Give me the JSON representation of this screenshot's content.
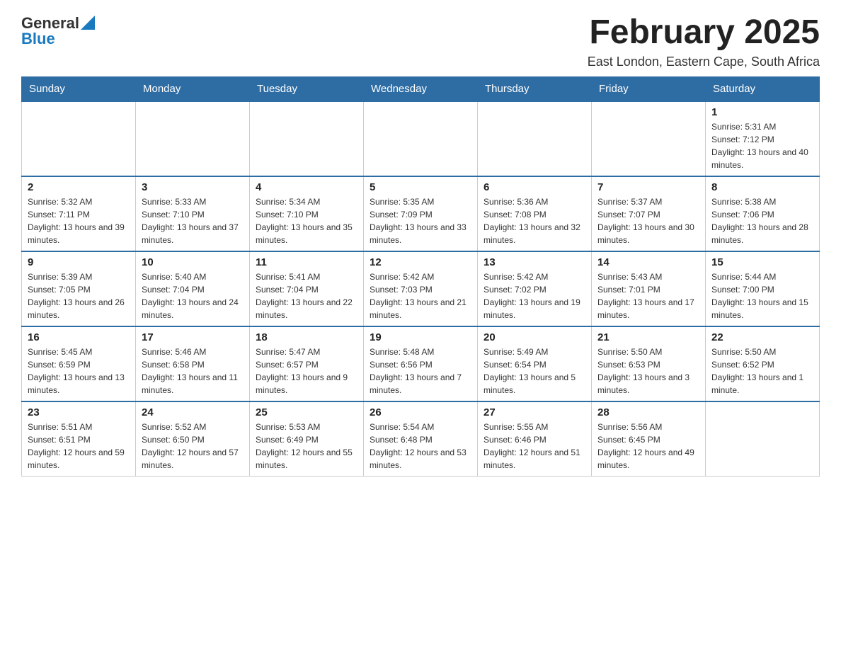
{
  "logo": {
    "general": "General",
    "blue": "Blue"
  },
  "title": "February 2025",
  "location": "East London, Eastern Cape, South Africa",
  "weekdays": [
    "Sunday",
    "Monday",
    "Tuesday",
    "Wednesday",
    "Thursday",
    "Friday",
    "Saturday"
  ],
  "weeks": [
    [
      {
        "day": "",
        "info": ""
      },
      {
        "day": "",
        "info": ""
      },
      {
        "day": "",
        "info": ""
      },
      {
        "day": "",
        "info": ""
      },
      {
        "day": "",
        "info": ""
      },
      {
        "day": "",
        "info": ""
      },
      {
        "day": "1",
        "info": "Sunrise: 5:31 AM\nSunset: 7:12 PM\nDaylight: 13 hours and 40 minutes."
      }
    ],
    [
      {
        "day": "2",
        "info": "Sunrise: 5:32 AM\nSunset: 7:11 PM\nDaylight: 13 hours and 39 minutes."
      },
      {
        "day": "3",
        "info": "Sunrise: 5:33 AM\nSunset: 7:10 PM\nDaylight: 13 hours and 37 minutes."
      },
      {
        "day": "4",
        "info": "Sunrise: 5:34 AM\nSunset: 7:10 PM\nDaylight: 13 hours and 35 minutes."
      },
      {
        "day": "5",
        "info": "Sunrise: 5:35 AM\nSunset: 7:09 PM\nDaylight: 13 hours and 33 minutes."
      },
      {
        "day": "6",
        "info": "Sunrise: 5:36 AM\nSunset: 7:08 PM\nDaylight: 13 hours and 32 minutes."
      },
      {
        "day": "7",
        "info": "Sunrise: 5:37 AM\nSunset: 7:07 PM\nDaylight: 13 hours and 30 minutes."
      },
      {
        "day": "8",
        "info": "Sunrise: 5:38 AM\nSunset: 7:06 PM\nDaylight: 13 hours and 28 minutes."
      }
    ],
    [
      {
        "day": "9",
        "info": "Sunrise: 5:39 AM\nSunset: 7:05 PM\nDaylight: 13 hours and 26 minutes."
      },
      {
        "day": "10",
        "info": "Sunrise: 5:40 AM\nSunset: 7:04 PM\nDaylight: 13 hours and 24 minutes."
      },
      {
        "day": "11",
        "info": "Sunrise: 5:41 AM\nSunset: 7:04 PM\nDaylight: 13 hours and 22 minutes."
      },
      {
        "day": "12",
        "info": "Sunrise: 5:42 AM\nSunset: 7:03 PM\nDaylight: 13 hours and 21 minutes."
      },
      {
        "day": "13",
        "info": "Sunrise: 5:42 AM\nSunset: 7:02 PM\nDaylight: 13 hours and 19 minutes."
      },
      {
        "day": "14",
        "info": "Sunrise: 5:43 AM\nSunset: 7:01 PM\nDaylight: 13 hours and 17 minutes."
      },
      {
        "day": "15",
        "info": "Sunrise: 5:44 AM\nSunset: 7:00 PM\nDaylight: 13 hours and 15 minutes."
      }
    ],
    [
      {
        "day": "16",
        "info": "Sunrise: 5:45 AM\nSunset: 6:59 PM\nDaylight: 13 hours and 13 minutes."
      },
      {
        "day": "17",
        "info": "Sunrise: 5:46 AM\nSunset: 6:58 PM\nDaylight: 13 hours and 11 minutes."
      },
      {
        "day": "18",
        "info": "Sunrise: 5:47 AM\nSunset: 6:57 PM\nDaylight: 13 hours and 9 minutes."
      },
      {
        "day": "19",
        "info": "Sunrise: 5:48 AM\nSunset: 6:56 PM\nDaylight: 13 hours and 7 minutes."
      },
      {
        "day": "20",
        "info": "Sunrise: 5:49 AM\nSunset: 6:54 PM\nDaylight: 13 hours and 5 minutes."
      },
      {
        "day": "21",
        "info": "Sunrise: 5:50 AM\nSunset: 6:53 PM\nDaylight: 13 hours and 3 minutes."
      },
      {
        "day": "22",
        "info": "Sunrise: 5:50 AM\nSunset: 6:52 PM\nDaylight: 13 hours and 1 minute."
      }
    ],
    [
      {
        "day": "23",
        "info": "Sunrise: 5:51 AM\nSunset: 6:51 PM\nDaylight: 12 hours and 59 minutes."
      },
      {
        "day": "24",
        "info": "Sunrise: 5:52 AM\nSunset: 6:50 PM\nDaylight: 12 hours and 57 minutes."
      },
      {
        "day": "25",
        "info": "Sunrise: 5:53 AM\nSunset: 6:49 PM\nDaylight: 12 hours and 55 minutes."
      },
      {
        "day": "26",
        "info": "Sunrise: 5:54 AM\nSunset: 6:48 PM\nDaylight: 12 hours and 53 minutes."
      },
      {
        "day": "27",
        "info": "Sunrise: 5:55 AM\nSunset: 6:46 PM\nDaylight: 12 hours and 51 minutes."
      },
      {
        "day": "28",
        "info": "Sunrise: 5:56 AM\nSunset: 6:45 PM\nDaylight: 12 hours and 49 minutes."
      },
      {
        "day": "",
        "info": ""
      }
    ]
  ]
}
